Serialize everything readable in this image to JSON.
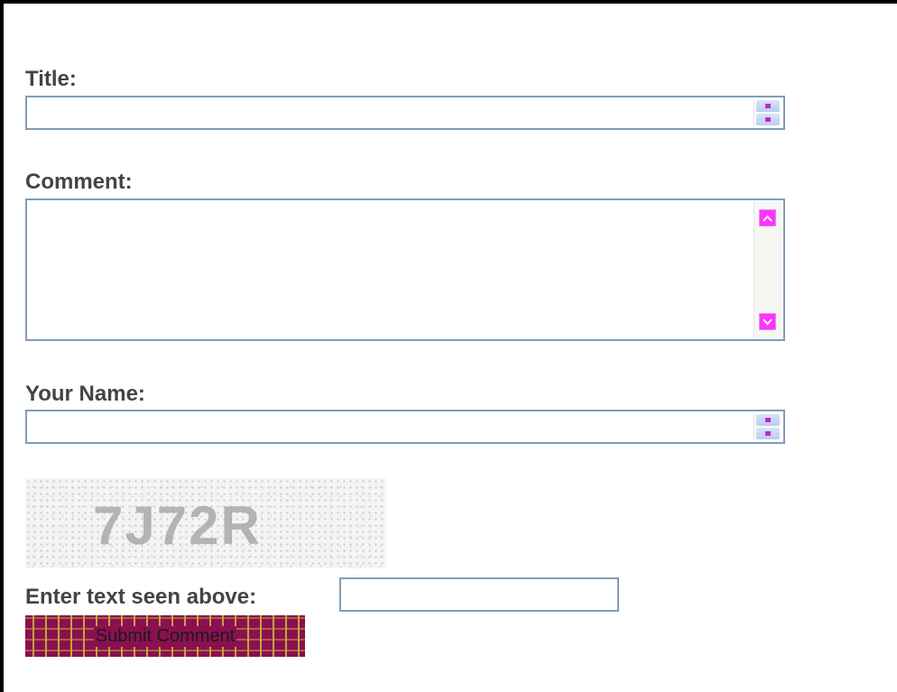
{
  "form": {
    "title_label": "Title:",
    "title_value": "",
    "comment_label": "Comment:",
    "comment_value": "",
    "name_label": "Your Name:",
    "name_value": "",
    "captcha_text": "7J72R",
    "captcha_label": "Enter text seen above:",
    "captcha_value": "",
    "submit_label": "Submit Comment"
  },
  "colors": {
    "label_text": "#444444",
    "field_border": "#7f9db9",
    "scroll_button": "#ff33ff",
    "submit_background": "#8a1050",
    "submit_pattern": "#c8a23a"
  },
  "icons": {
    "spinner": "up-down-spinner-icon",
    "scroll_up": "chevron-up-icon",
    "scroll_down": "chevron-down-icon"
  }
}
